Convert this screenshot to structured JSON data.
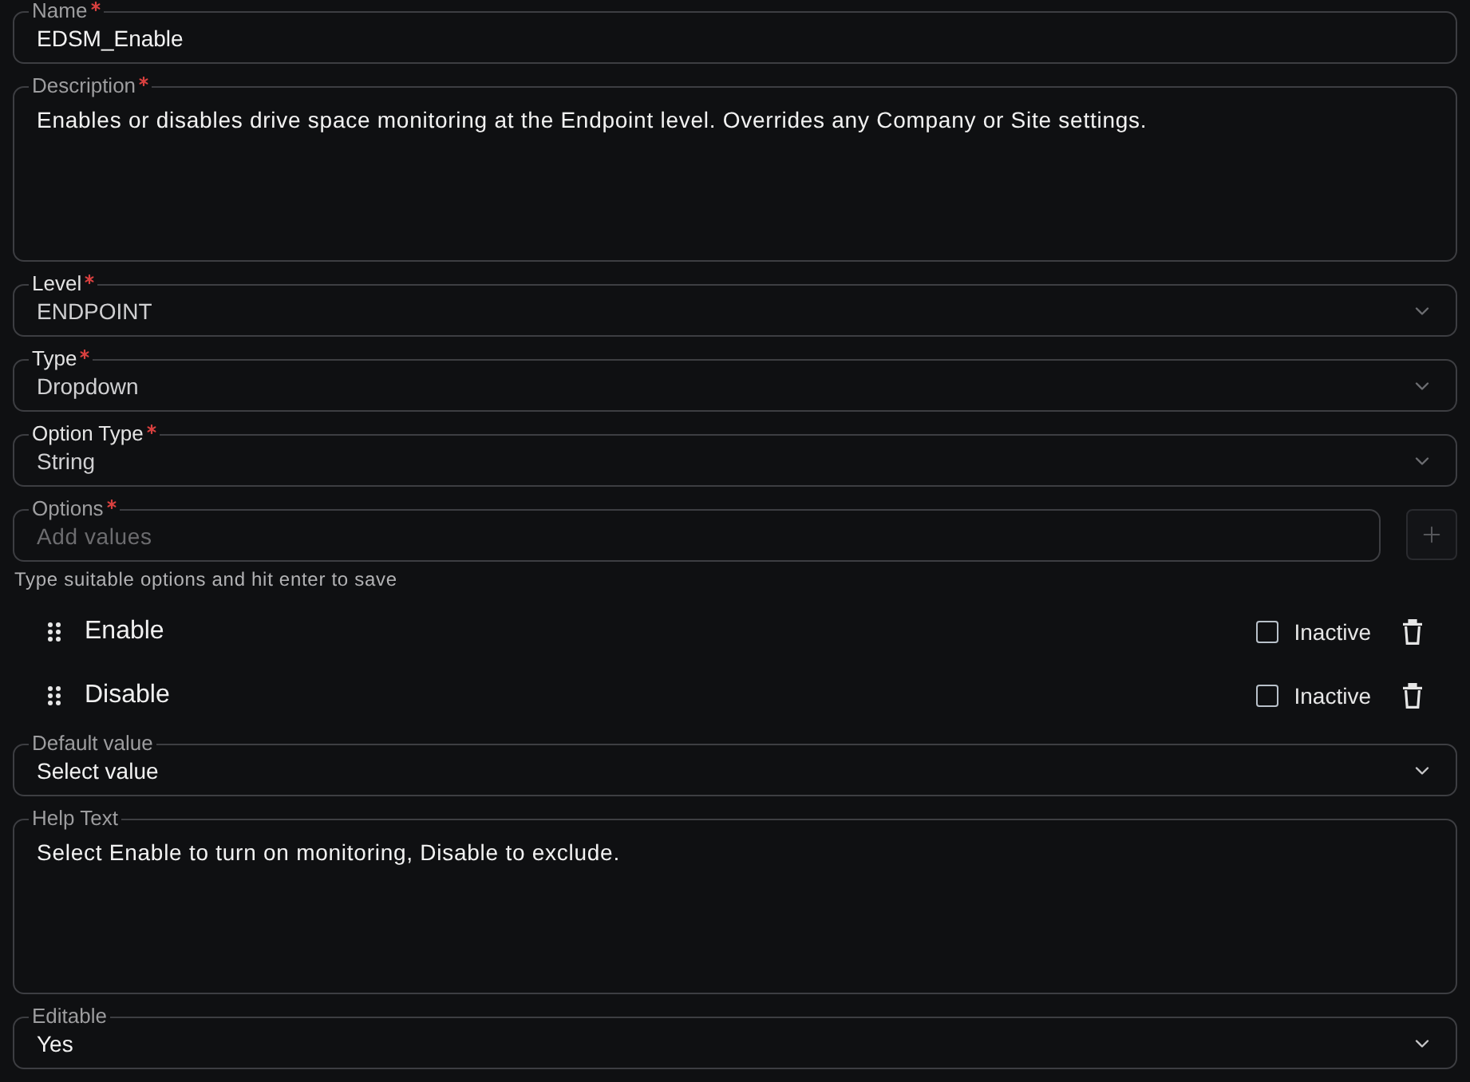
{
  "fields": [
    {
      "kind": "text",
      "label": "Name",
      "required": true,
      "disabled": false,
      "value": "EDSM_Enable"
    },
    {
      "kind": "textarea",
      "label": "Description",
      "required": true,
      "disabled": false,
      "value": "Enables or disables drive space monitoring at the Endpoint level. Overrides any Company or Site settings."
    },
    {
      "kind": "select",
      "label": "Level",
      "required": true,
      "disabled": true,
      "value": "ENDPOINT"
    },
    {
      "kind": "select",
      "label": "Type",
      "required": true,
      "disabled": true,
      "value": "Dropdown"
    },
    {
      "kind": "select",
      "label": "Option Type",
      "required": true,
      "disabled": true,
      "value": "String"
    },
    {
      "kind": "tags",
      "label": "Options",
      "required": true,
      "disabled": false,
      "placeholder": "Add values",
      "hint": "Type suitable options and hit enter to save",
      "items": [
        {
          "label": "Enable",
          "inactive": false,
          "inactive_label": "Inactive"
        },
        {
          "label": "Disable",
          "inactive": false,
          "inactive_label": "Inactive"
        }
      ]
    },
    {
      "kind": "select",
      "label": "Default value",
      "required": false,
      "disabled": false,
      "value": "Select value"
    },
    {
      "kind": "textarea",
      "label": "Help Text",
      "required": false,
      "disabled": false,
      "value": "Select Enable to turn on monitoring, Disable to exclude."
    },
    {
      "kind": "select",
      "label": "Editable",
      "required": false,
      "disabled": false,
      "value": "Yes"
    }
  ]
}
